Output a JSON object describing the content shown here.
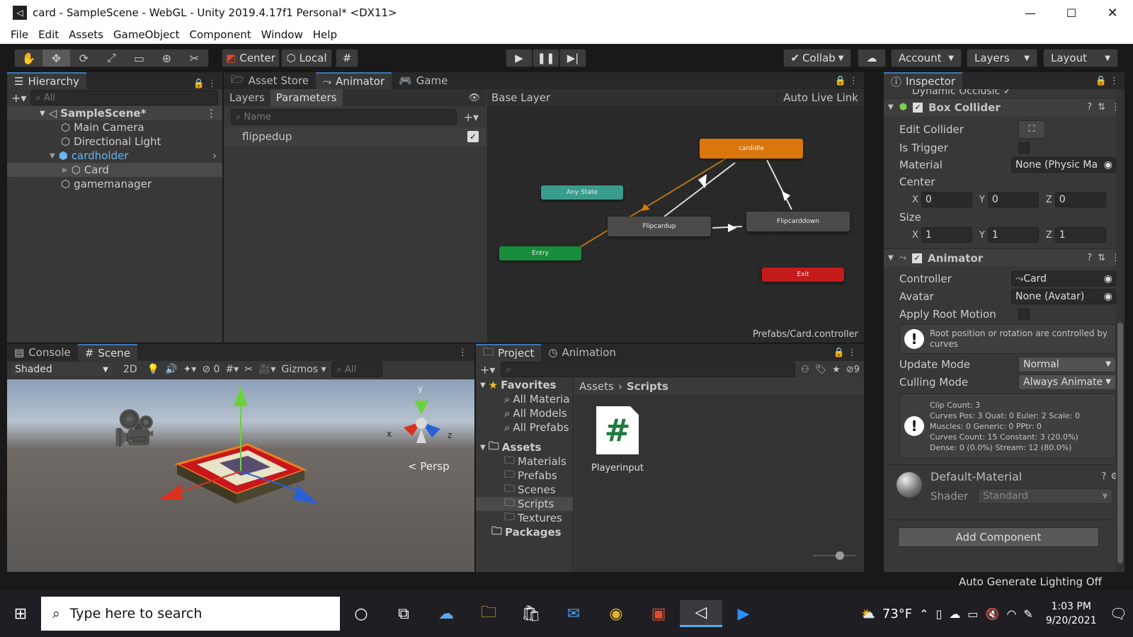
{
  "window": {
    "title": "card - SampleScene - WebGL - Unity 2019.4.17f1 Personal* <DX11>"
  },
  "menu": [
    "File",
    "Edit",
    "Assets",
    "GameObject",
    "Component",
    "Window",
    "Help"
  ],
  "toolbar": {
    "center": "Center",
    "local": "Local",
    "collab": "Collab",
    "account": "Account",
    "layers": "Layers",
    "layout": "Layout"
  },
  "hierarchy": {
    "tab": "Hierarchy",
    "search": "All",
    "scene": "SampleScene*",
    "items": [
      "Main Camera",
      "Directional Light",
      "cardholder",
      "Card",
      "gamemanager"
    ]
  },
  "center_tabs": [
    "Asset Store",
    "Animator",
    "Game"
  ],
  "animator": {
    "layers_tab": "Layers",
    "params_tab": "Parameters",
    "search_placeholder": "Name",
    "param": "flippedup",
    "breadcrumb": "Base Layer",
    "auto_live": "Auto Live Link",
    "footer": "Prefabs/Card.controller",
    "nodes": {
      "idle": "cardidle",
      "any": "Any State",
      "flipup": "Flipcardup",
      "flipdown": "Flipcarddown",
      "entry": "Entry",
      "exit": "Exit"
    }
  },
  "scene": {
    "console_tab": "Console",
    "scene_tab": "Scene",
    "shaded": "Shaded",
    "mode_2d": "2D",
    "hidden_count": "0",
    "gizmos": "Gizmos",
    "search": "All",
    "persp": "Persp",
    "axis_x": "x",
    "axis_y": "y",
    "axis_z": "z"
  },
  "project": {
    "tab": "Project",
    "anim_tab": "Animation",
    "hidden_count": "9",
    "favorites": "Favorites",
    "fav_items": [
      "All Materia",
      "All Models",
      "All Prefabs"
    ],
    "assets": "Assets",
    "asset_folders": [
      "Materials",
      "Prefabs",
      "Scenes",
      "Scripts",
      "Textures"
    ],
    "packages": "Packages",
    "breadcrumb_root": "Assets",
    "breadcrumb_leaf": "Scripts",
    "file": "Playerinput",
    "file_glyph": "#"
  },
  "inspector": {
    "tab": "Inspector",
    "top_cut": "Dynamic Occlusic",
    "box_collider": {
      "title": "Box Collider",
      "edit": "Edit Collider",
      "is_trigger": "Is Trigger",
      "material": "Material",
      "material_val": "None (Physic Ma",
      "center": "Center",
      "size": "Size",
      "cx": "0",
      "cy": "0",
      "cz": "0",
      "sx": "1",
      "sy": "1",
      "sz": "1"
    },
    "animator": {
      "title": "Animator",
      "controller": "Controller",
      "controller_val": "Card",
      "avatar": "Avatar",
      "avatar_val": "None (Avatar)",
      "root_motion": "Apply Root Motion",
      "info": "Root position or rotation are controlled by curves",
      "update_mode": "Update Mode",
      "update_val": "Normal",
      "culling_mode": "Culling Mode",
      "culling_val": "Always Animate",
      "stats": [
        "Clip Count: 3",
        "Curves Pos: 3 Quat: 0 Euler: 2 Scale: 0",
        "Muscles: 0 Generic: 0 PPtr: 0",
        "Curves Count: 15 Constant: 3 (20.0%)",
        "Dense: 0 (0.0%) Stream: 12 (80.0%)"
      ]
    },
    "material": {
      "name": "Default-Material",
      "shader_label": "Shader",
      "shader_val": "Standard"
    },
    "add_component": "Add Component"
  },
  "status": "Auto Generate Lighting Off",
  "taskbar": {
    "search": "Type here to search",
    "temp": "73°F",
    "time": "1:03 PM",
    "date": "9/20/2021"
  },
  "colors": {
    "accent": "#3a79bb",
    "idle": "#d9770d",
    "any": "#3a9c8c",
    "entry": "#188c3a",
    "exit": "#c41b1b"
  }
}
